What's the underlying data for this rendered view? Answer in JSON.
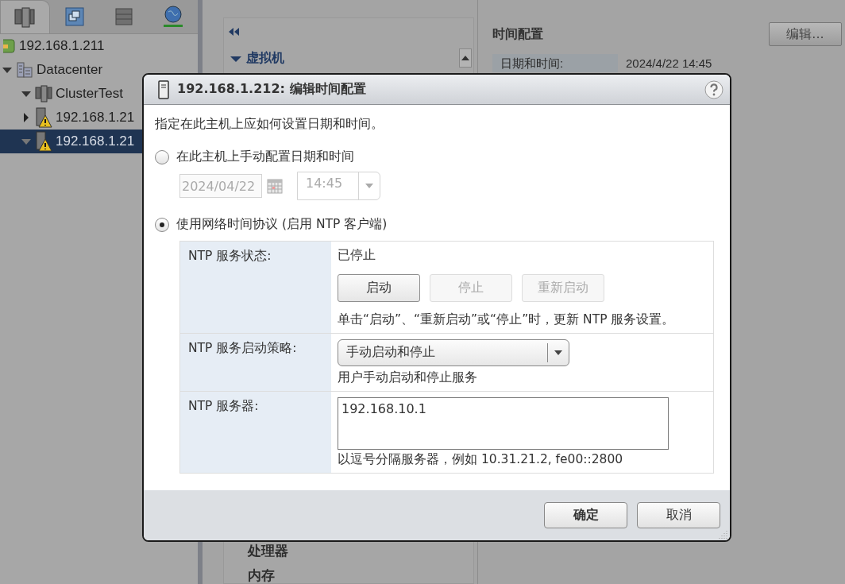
{
  "nav_tabs": [
    {
      "kind": "hosts",
      "selected": true
    },
    {
      "kind": "vms",
      "selected": false
    },
    {
      "kind": "storage",
      "selected": false
    },
    {
      "kind": "network",
      "selected": false
    }
  ],
  "tree": [
    {
      "label": "192.168.1.211",
      "kind": "vcenter",
      "selected": false,
      "children": [
        {
          "label": "Datacenter",
          "kind": "datacenter",
          "selected": false,
          "expanded": true,
          "children": [
            {
              "label": "ClusterTest",
              "kind": "cluster",
              "selected": false,
              "expanded": true,
              "children": [
                {
                  "label": "192.168.1.21",
                  "kind": "host-warning",
                  "selected": false,
                  "expanded": false
                },
                {
                  "label": "192.168.1.21",
                  "kind": "host-warning",
                  "selected": true,
                  "expanded": true
                }
              ]
            }
          ]
        }
      ]
    }
  ],
  "middle_panel": {
    "section": "虚拟机",
    "items_below": [
      "处理器",
      "内存"
    ]
  },
  "right_panel": {
    "title": "时间配置",
    "edit_button": "编辑...",
    "rows": [
      {
        "label": "日期和时间:",
        "value": "2024/4/22 14:45"
      }
    ]
  },
  "dialog": {
    "title": "192.168.1.212: 编辑时间配置",
    "intro": "指定在此主机上应如何设置日期和时间。",
    "options": [
      {
        "label": "在此主机上手动配置日期和时间",
        "selected": false
      },
      {
        "label": "使用网络时间协议 (启用 NTP 客户端)",
        "selected": true
      }
    ],
    "manual": {
      "date": "2024/04/22",
      "time": "14:45",
      "disabled": true
    },
    "ntp": {
      "status_label": "NTP 服务状态:",
      "status": "已停止",
      "buttons": [
        {
          "label": "启动",
          "disabled": false
        },
        {
          "label": "停止",
          "disabled": true
        },
        {
          "label": "重新启动",
          "disabled": true
        }
      ],
      "status_hint": "单击“启动”、“重新启动”或“停止”时，更新 NTP 服务设置。",
      "policy_label": "NTP 服务启动策略:",
      "policy": "手动启动和停止",
      "policy_hint": "用户手动启动和停止服务",
      "servers_label": "NTP 服务器:",
      "servers": "192.168.10.1",
      "servers_hint": "以逗号分隔服务器，例如 10.31.21.2, fe00::2800"
    },
    "footer_buttons": [
      "确定",
      "取消"
    ]
  }
}
